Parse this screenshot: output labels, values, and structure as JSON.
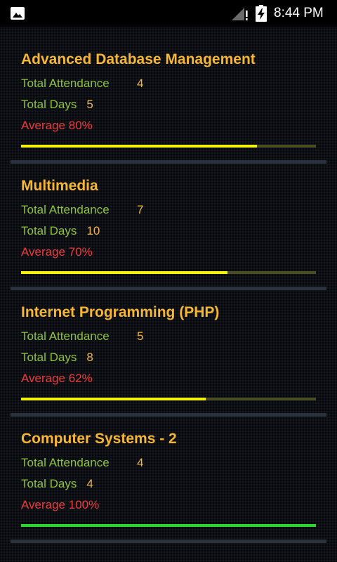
{
  "status_bar": {
    "time": "8:44 PM",
    "icons": [
      "image-icon",
      "signal-icon",
      "battery-charging-icon"
    ]
  },
  "labels": {
    "total_attendance": "Total Attendance",
    "total_days": "Total Days"
  },
  "colors": {
    "title": "#f7b733",
    "label": "#8fc23d",
    "value": "#f0b64a",
    "average": "#ef3b3b",
    "progress_fill": "#f2f20a",
    "progress_complete": "#2ed52e",
    "progress_track": "#4a4d22"
  },
  "subjects": [
    {
      "title": "Advanced Database Management",
      "total_attendance": "4",
      "total_days": "5",
      "average": "Average 80%",
      "progress": 0.8
    },
    {
      "title": "Multimedia",
      "total_attendance": "7",
      "total_days": "10",
      "average": "Average 70%",
      "progress": 0.7
    },
    {
      "title": "Internet Programming (PHP)",
      "total_attendance": "5",
      "total_days": "8",
      "average": "Average 62%",
      "progress": 0.625
    },
    {
      "title": "Computer Systems - 2",
      "total_attendance": "4",
      "total_days": "4",
      "average": "Average 100%",
      "progress": 1.0
    }
  ]
}
